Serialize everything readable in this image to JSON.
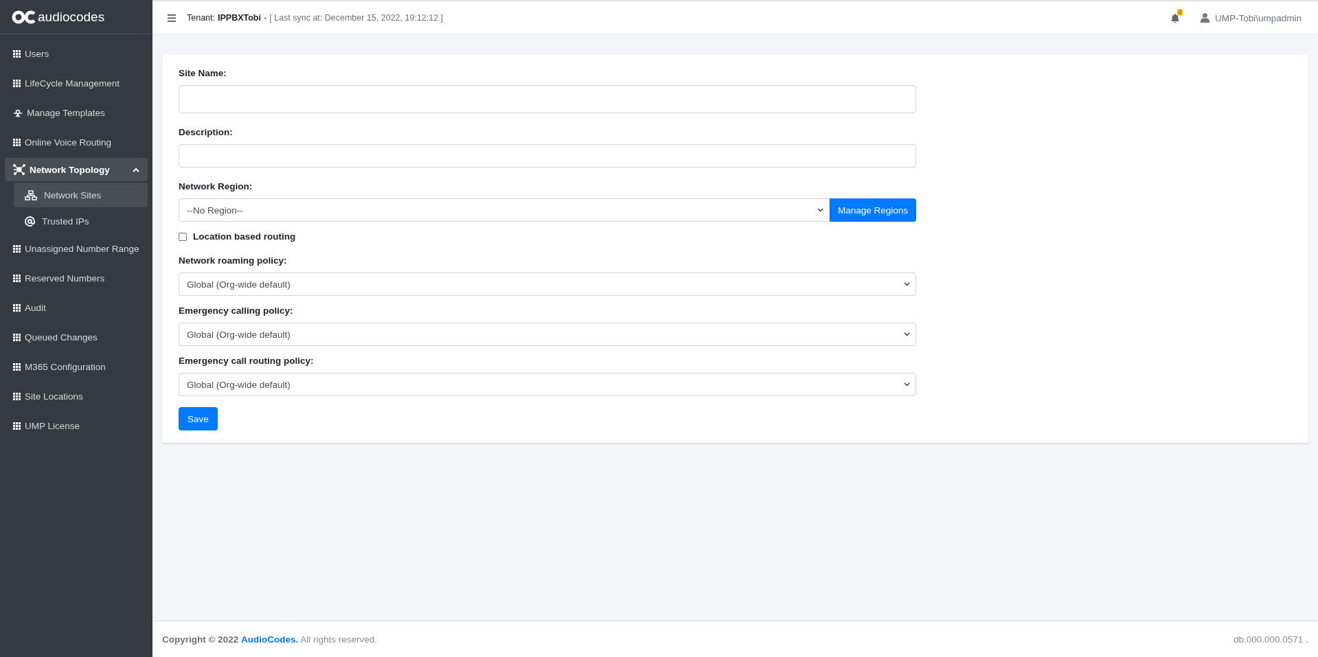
{
  "logo": {
    "text": "audiocodes"
  },
  "sidebar": {
    "items": [
      {
        "label": "Users",
        "kind": "grid",
        "selected": false
      },
      {
        "label": "LifeCycle Management",
        "kind": "grid",
        "selected": false
      },
      {
        "label": "Manage Templates",
        "kind": "templates",
        "selected": false
      },
      {
        "label": "Online Voice Routing",
        "kind": "grid",
        "selected": false
      },
      {
        "label": "Network Topology",
        "kind": "topology",
        "selected": false,
        "expanded": true,
        "children": [
          {
            "label": "Network Sites",
            "kind": "sites",
            "selected": true
          },
          {
            "label": "Trusted IPs",
            "kind": "at",
            "selected": false
          }
        ]
      },
      {
        "label": "Unassigned Number Range",
        "kind": "grid",
        "selected": false
      },
      {
        "label": "Reserved Numbers",
        "kind": "grid",
        "selected": false
      },
      {
        "label": "Audit",
        "kind": "grid",
        "selected": false
      },
      {
        "label": "Queued Changes",
        "kind": "grid",
        "selected": false
      },
      {
        "label": "M365 Configuration",
        "kind": "grid",
        "selected": false
      },
      {
        "label": "Site Locations",
        "kind": "grid",
        "selected": false
      },
      {
        "label": "UMP License",
        "kind": "grid",
        "selected": false
      }
    ]
  },
  "header": {
    "tenant_label": "Tenant:",
    "tenant_name": "IPPBXTobi",
    "separator": "-",
    "sync": "[ Last sync at: December 15, 2022, 19:12:12 ]",
    "notification_count": "0",
    "user": "UMP-Tobi\\umpadmin"
  },
  "form": {
    "fields": [
      {
        "kind": "text",
        "label": "Site Name:"
      },
      {
        "kind": "text",
        "label": "Description:"
      },
      {
        "kind": "select_button",
        "label": "Network Region:",
        "value": "--No Region--",
        "button": "Manage Regions"
      },
      {
        "kind": "checkbox",
        "label": "Location based routing",
        "checked": false
      },
      {
        "kind": "select",
        "label": "Network roaming policy:",
        "value": "Global (Org-wide default)"
      },
      {
        "kind": "select",
        "label": "Emergency calling policy:",
        "value": "Global (Org-wide default)"
      },
      {
        "kind": "select",
        "label": "Emergency call routing policy:",
        "value": "Global (Org-wide default)"
      }
    ],
    "submit": "Save"
  },
  "footer": {
    "copyright": "Copyright © 2022",
    "company": "AudioCodes.",
    "rights": "All rights reserved.",
    "version": "db.000.000.0571",
    "version_suffix": "."
  }
}
